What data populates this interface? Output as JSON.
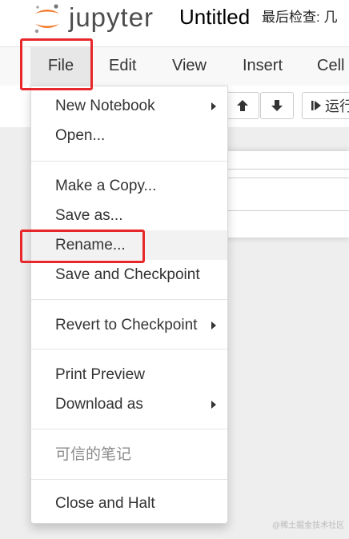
{
  "header": {
    "logo_text": "jupyter",
    "notebook_title": "Untitled",
    "checkpoint_text": "最后检查: 几"
  },
  "menubar": {
    "items": [
      "File",
      "Edit",
      "View",
      "Insert",
      "Cell"
    ]
  },
  "toolbar": {
    "up_icon": "arrow-up-icon",
    "down_icon": "arrow-down-icon",
    "run_label": "运行"
  },
  "file_menu": {
    "items": [
      {
        "label": "New Notebook",
        "submenu": true
      },
      {
        "label": "Open...",
        "submenu": false
      },
      {
        "label": "Make a Copy...",
        "submenu": false
      },
      {
        "label": "Save as...",
        "submenu": false
      },
      {
        "label": "Rename...",
        "submenu": false
      },
      {
        "label": "Save and Checkpoint",
        "submenu": false
      },
      {
        "label": "Revert to Checkpoint",
        "submenu": true
      },
      {
        "label": "Print Preview",
        "submenu": false
      },
      {
        "label": "Download as",
        "submenu": true
      },
      {
        "label": "可信的笔记",
        "submenu": false,
        "disabled": true
      },
      {
        "label": "Close and Halt",
        "submenu": false
      }
    ]
  },
  "watermark": "@稀土掘金技术社区",
  "colors": {
    "highlight": "#e8272b",
    "jupyter_orange": "#f37726",
    "menu_active_bg": "#e7e7e7"
  }
}
